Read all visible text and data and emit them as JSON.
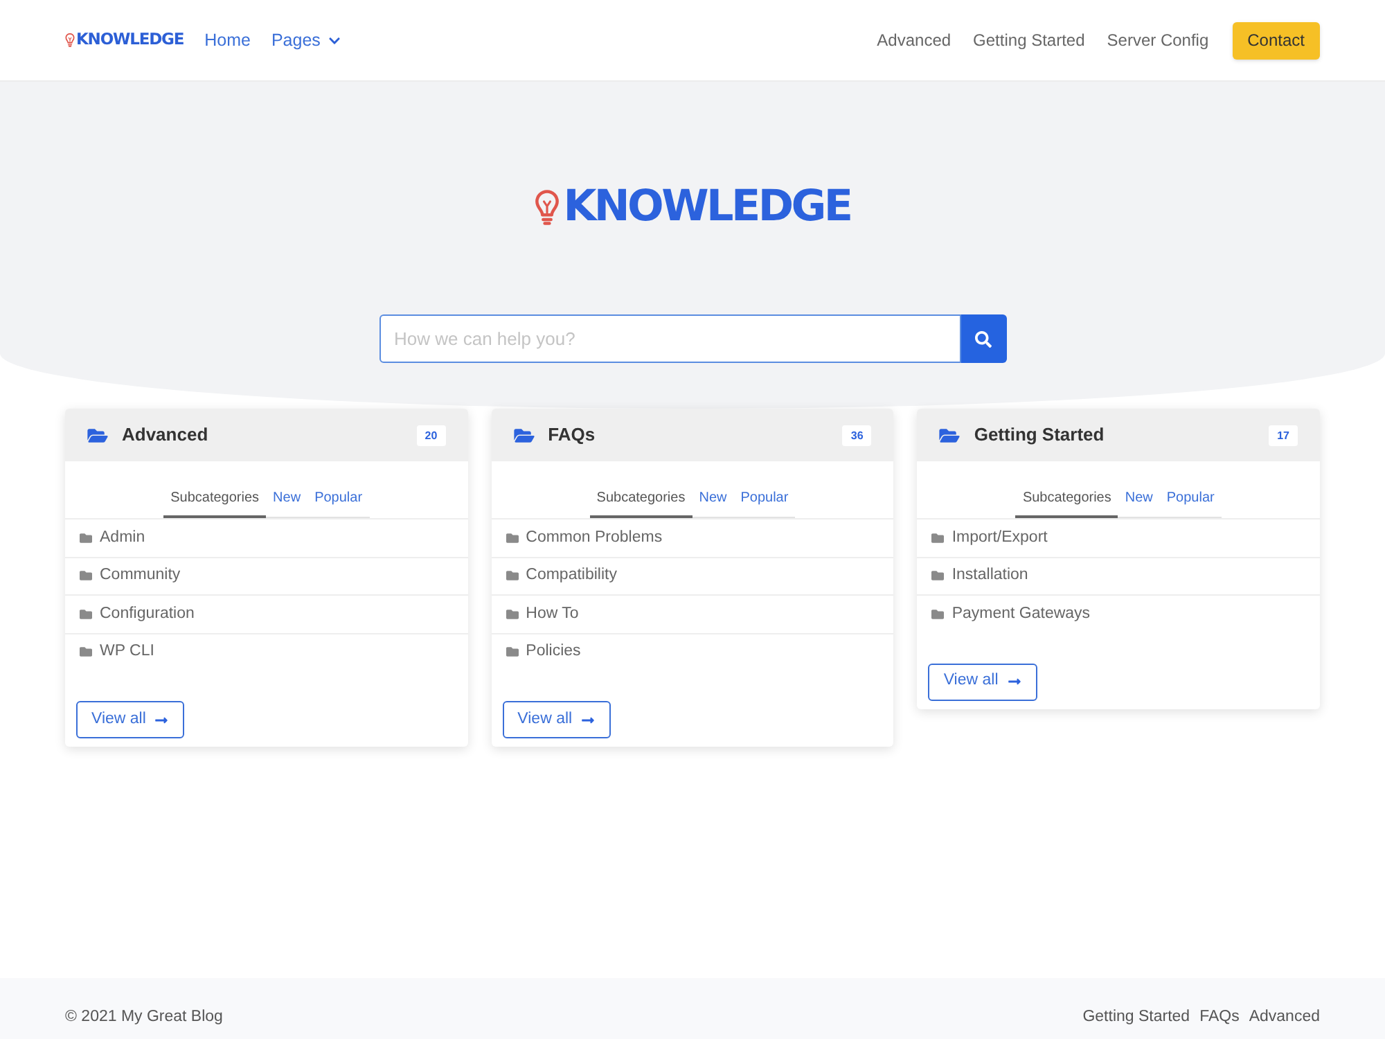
{
  "header": {
    "logo": "KNOWLEDGE",
    "nav_left": [
      {
        "label": "Home",
        "dropdown": false
      },
      {
        "label": "Pages",
        "dropdown": true
      }
    ],
    "nav_right": [
      "Advanced",
      "Getting Started",
      "Server Config"
    ],
    "cta": "Contact"
  },
  "hero": {
    "logo": "KNOWLEDGE",
    "search": {
      "placeholder": "How we can help you?"
    }
  },
  "categories": [
    {
      "title": "Advanced",
      "count": "20",
      "tabs": [
        {
          "label": "Subcategories",
          "selected": true
        },
        {
          "label": "New",
          "selected": false
        },
        {
          "label": "Popular",
          "selected": false
        }
      ],
      "items": [
        "Admin",
        "Community",
        "Configuration",
        "WP CLI"
      ],
      "button": "View all"
    },
    {
      "title": "FAQs",
      "count": "36",
      "tabs": [
        {
          "label": "Subcategories",
          "selected": true
        },
        {
          "label": "New",
          "selected": false
        },
        {
          "label": "Popular",
          "selected": false
        }
      ],
      "items": [
        "Common Problems",
        "Compatibility",
        "How To",
        "Policies"
      ],
      "button": "View all"
    },
    {
      "title": "Getting Started",
      "count": "17",
      "tabs": [
        {
          "label": "Subcategories",
          "selected": true
        },
        {
          "label": "New",
          "selected": false
        },
        {
          "label": "Popular",
          "selected": false
        }
      ],
      "items": [
        "Import/Export",
        "Installation",
        "Payment Gateways"
      ],
      "button": "View all"
    }
  ],
  "footer": {
    "copyright": "© 2021 My Great Blog",
    "links": [
      "Getting Started",
      "FAQs",
      "Advanced"
    ]
  }
}
